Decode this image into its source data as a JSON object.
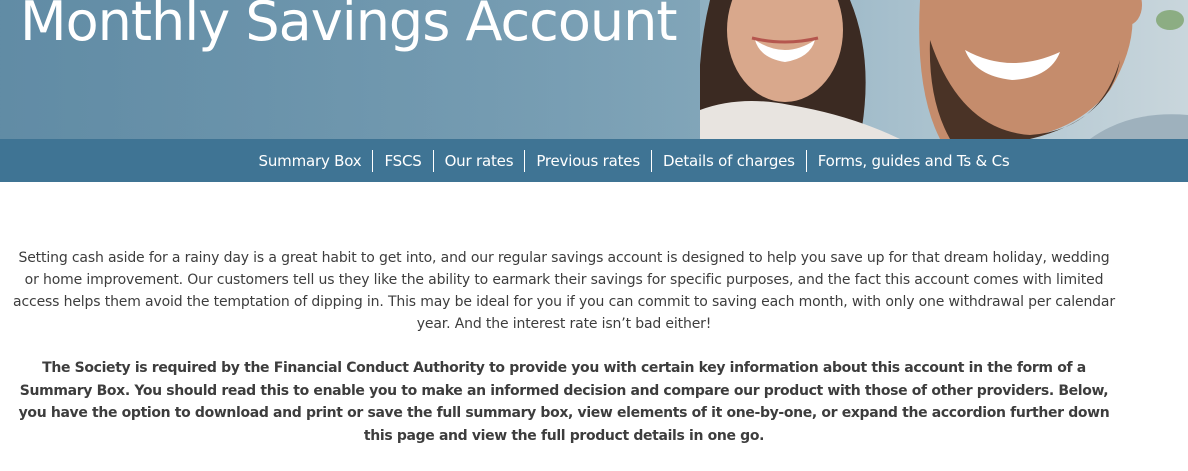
{
  "hero": {
    "title": "Monthly Savings Account"
  },
  "subnav": {
    "items": [
      {
        "label": "Summary Box"
      },
      {
        "label": "FSCS"
      },
      {
        "label": "Our rates"
      },
      {
        "label": "Previous rates"
      },
      {
        "label": "Details of charges"
      },
      {
        "label": "Forms, guides and Ts & Cs"
      }
    ]
  },
  "content": {
    "intro": "Setting cash aside for a rainy day is a great habit to get into, and our regular savings account is designed to help you save up for that dream holiday, wedding or home improvement. Our customers tell us they like the ability to earmark their savings for specific purposes, and the fact this account comes with limited access helps them avoid the temptation of dipping in. This may be ideal for you if you can commit to saving each month, with only one withdrawal per calendar year. And the interest rate isn’t bad either!",
    "notice": "The Society is required by the Financial Conduct Authority to provide you with certain key information about this account in the form of a Summary Box. You should read this to enable you to make an informed decision and compare our product with those of other providers. Below, you have the option to download and print or save the full summary box, view elements of it one-by-one, or expand the accordion further down this page and view the full product details in one go."
  },
  "colors": {
    "nav_background": "#3f7494",
    "hero_background": "#7ea3b7",
    "text": "#3d3d3d"
  }
}
